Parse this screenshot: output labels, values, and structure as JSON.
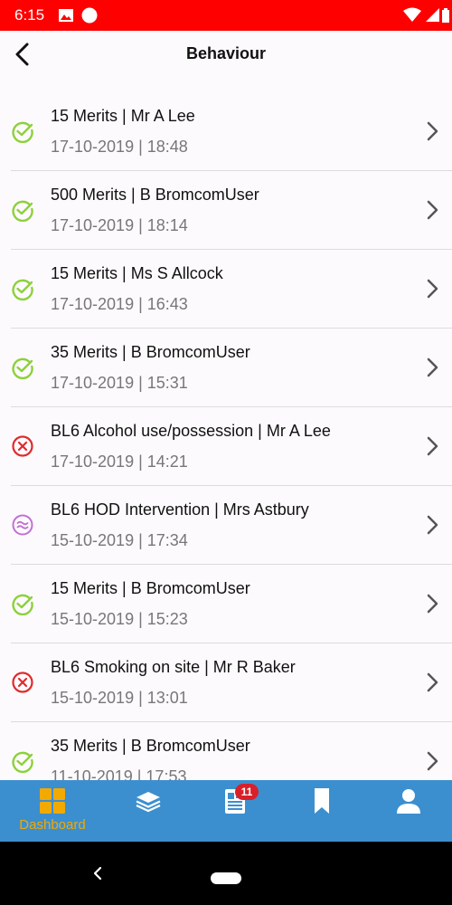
{
  "status_bar": {
    "time": "6:15"
  },
  "app_bar": {
    "title": "Behaviour"
  },
  "colors": {
    "status_bar": "#ff0000",
    "positive": "#8cd13a",
    "negative": "#e02b2b",
    "neutral": "#c071d6",
    "nav_bg": "#3c8fcf",
    "nav_active": "#f2a900"
  },
  "items": [
    {
      "title": "15 Merits | Mr A Lee",
      "subtitle": "17-10-2019 | 18:48",
      "status": "positive"
    },
    {
      "title": "500 Merits | B BromcomUser",
      "subtitle": "17-10-2019 | 18:14",
      "status": "positive"
    },
    {
      "title": "15 Merits | Ms S Allcock",
      "subtitle": "17-10-2019 | 16:43",
      "status": "positive"
    },
    {
      "title": "35 Merits | B BromcomUser",
      "subtitle": "17-10-2019 | 15:31",
      "status": "positive"
    },
    {
      "title": "BL6 Alcohol use/possession | Mr A Lee",
      "subtitle": "17-10-2019 | 14:21",
      "status": "negative"
    },
    {
      "title": "BL6 HOD Intervention | Mrs Astbury",
      "subtitle": "15-10-2019 | 17:34",
      "status": "neutral"
    },
    {
      "title": "15 Merits | B BromcomUser",
      "subtitle": "15-10-2019 | 15:23",
      "status": "positive"
    },
    {
      "title": "BL6 Smoking on site | Mr R Baker",
      "subtitle": "15-10-2019 | 13:01",
      "status": "negative"
    },
    {
      "title": "35 Merits | B BromcomUser",
      "subtitle": "11-10-2019 | 17:53",
      "status": "positive"
    }
  ],
  "bottom_nav": {
    "dashboard_label": "Dashboard",
    "messages_badge": "11",
    "icons": [
      "dashboard-icon",
      "layers-icon",
      "document-icon",
      "bookmark-icon",
      "profile-icon"
    ]
  }
}
